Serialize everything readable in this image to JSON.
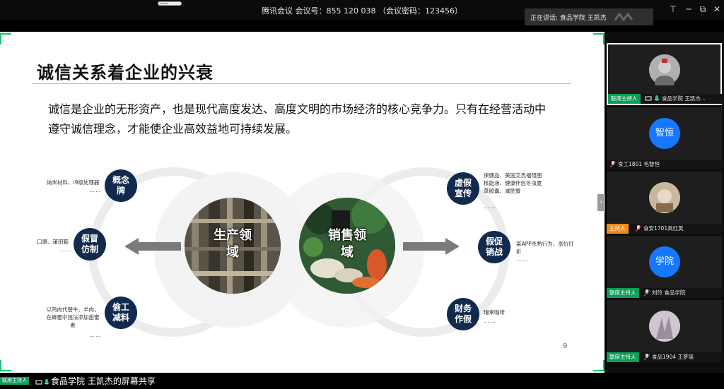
{
  "app": {
    "title": "腾讯会议  会议号：855 120 038  （会议密码：123456）",
    "speaking": "正在讲话: 食品学院  王凯杰"
  },
  "window_controls": {
    "pin": "⊤",
    "minimize": "─",
    "restore": "⧉",
    "close": "✕"
  },
  "slide": {
    "title": "诚信关系着企业的兴衰",
    "paragraph_line1": "诚信是企业的无形资产，也是现代高度发达、高度文明的市场经济的核心竞争力。只有在经营活动中",
    "paragraph_line2": "遵守诚信理念，才能使企业高效益地可持续发展。",
    "production_label": "生产领域",
    "sales_label": "销售领域",
    "page_number": "9",
    "left_nodes": [
      {
        "label": "概念牌",
        "note": "纳米材料、i9级处理器",
        "dots": "……"
      },
      {
        "label": "假冒仿制",
        "note": "口罩、莆田鞋",
        "dots": "……"
      },
      {
        "label": "偷工减料",
        "note": "以鸡肉代替牛、羊肉，在蜂蜜中违法添加甜蜜素",
        "dots": "……"
      }
    ],
    "right_nodes": [
      {
        "label": "虚假宣传",
        "note": "保健品、美国艾氏福阻图核能液、健康伴侣冬虫夏草胶囊、减肥餐",
        "dots": "……"
      },
      {
        "label": "假促销战",
        "note": "某APP杀熟行为、涨价打折",
        "dots": "……"
      },
      {
        "label": "财务作假",
        "note": "瑞幸咖啡",
        "dots": "……"
      }
    ]
  },
  "participants": [
    {
      "role": "联席主持人",
      "name": "食品学院  王凯杰...",
      "avatar": "photo-avatar",
      "role_color": "#0f9d58"
    },
    {
      "role": "",
      "name": "食工1801 毛智恒",
      "avatar_text": "智恒",
      "role_color": ""
    },
    {
      "role": "主持人",
      "name": "食安1701高红英",
      "avatar": "photo-avatar",
      "role_color": "#f08c1e"
    },
    {
      "role": "联席主持人",
      "name": "刘玲 食品学院",
      "avatar_text": "学院",
      "role_color": "#0f9d58"
    },
    {
      "role": "联席主持人",
      "name": "食品1904 王梦瑶",
      "avatar": "photo-avatar",
      "role_color": "#0f9d58"
    }
  ],
  "bottom": {
    "badge": "联席主持人",
    "share_text": "食品学院  王凯杰的屏幕共享"
  },
  "colors": {
    "accent_green": "#12c86a",
    "node_navy": "#122a4e",
    "blue_avatar": "#1677ff"
  }
}
